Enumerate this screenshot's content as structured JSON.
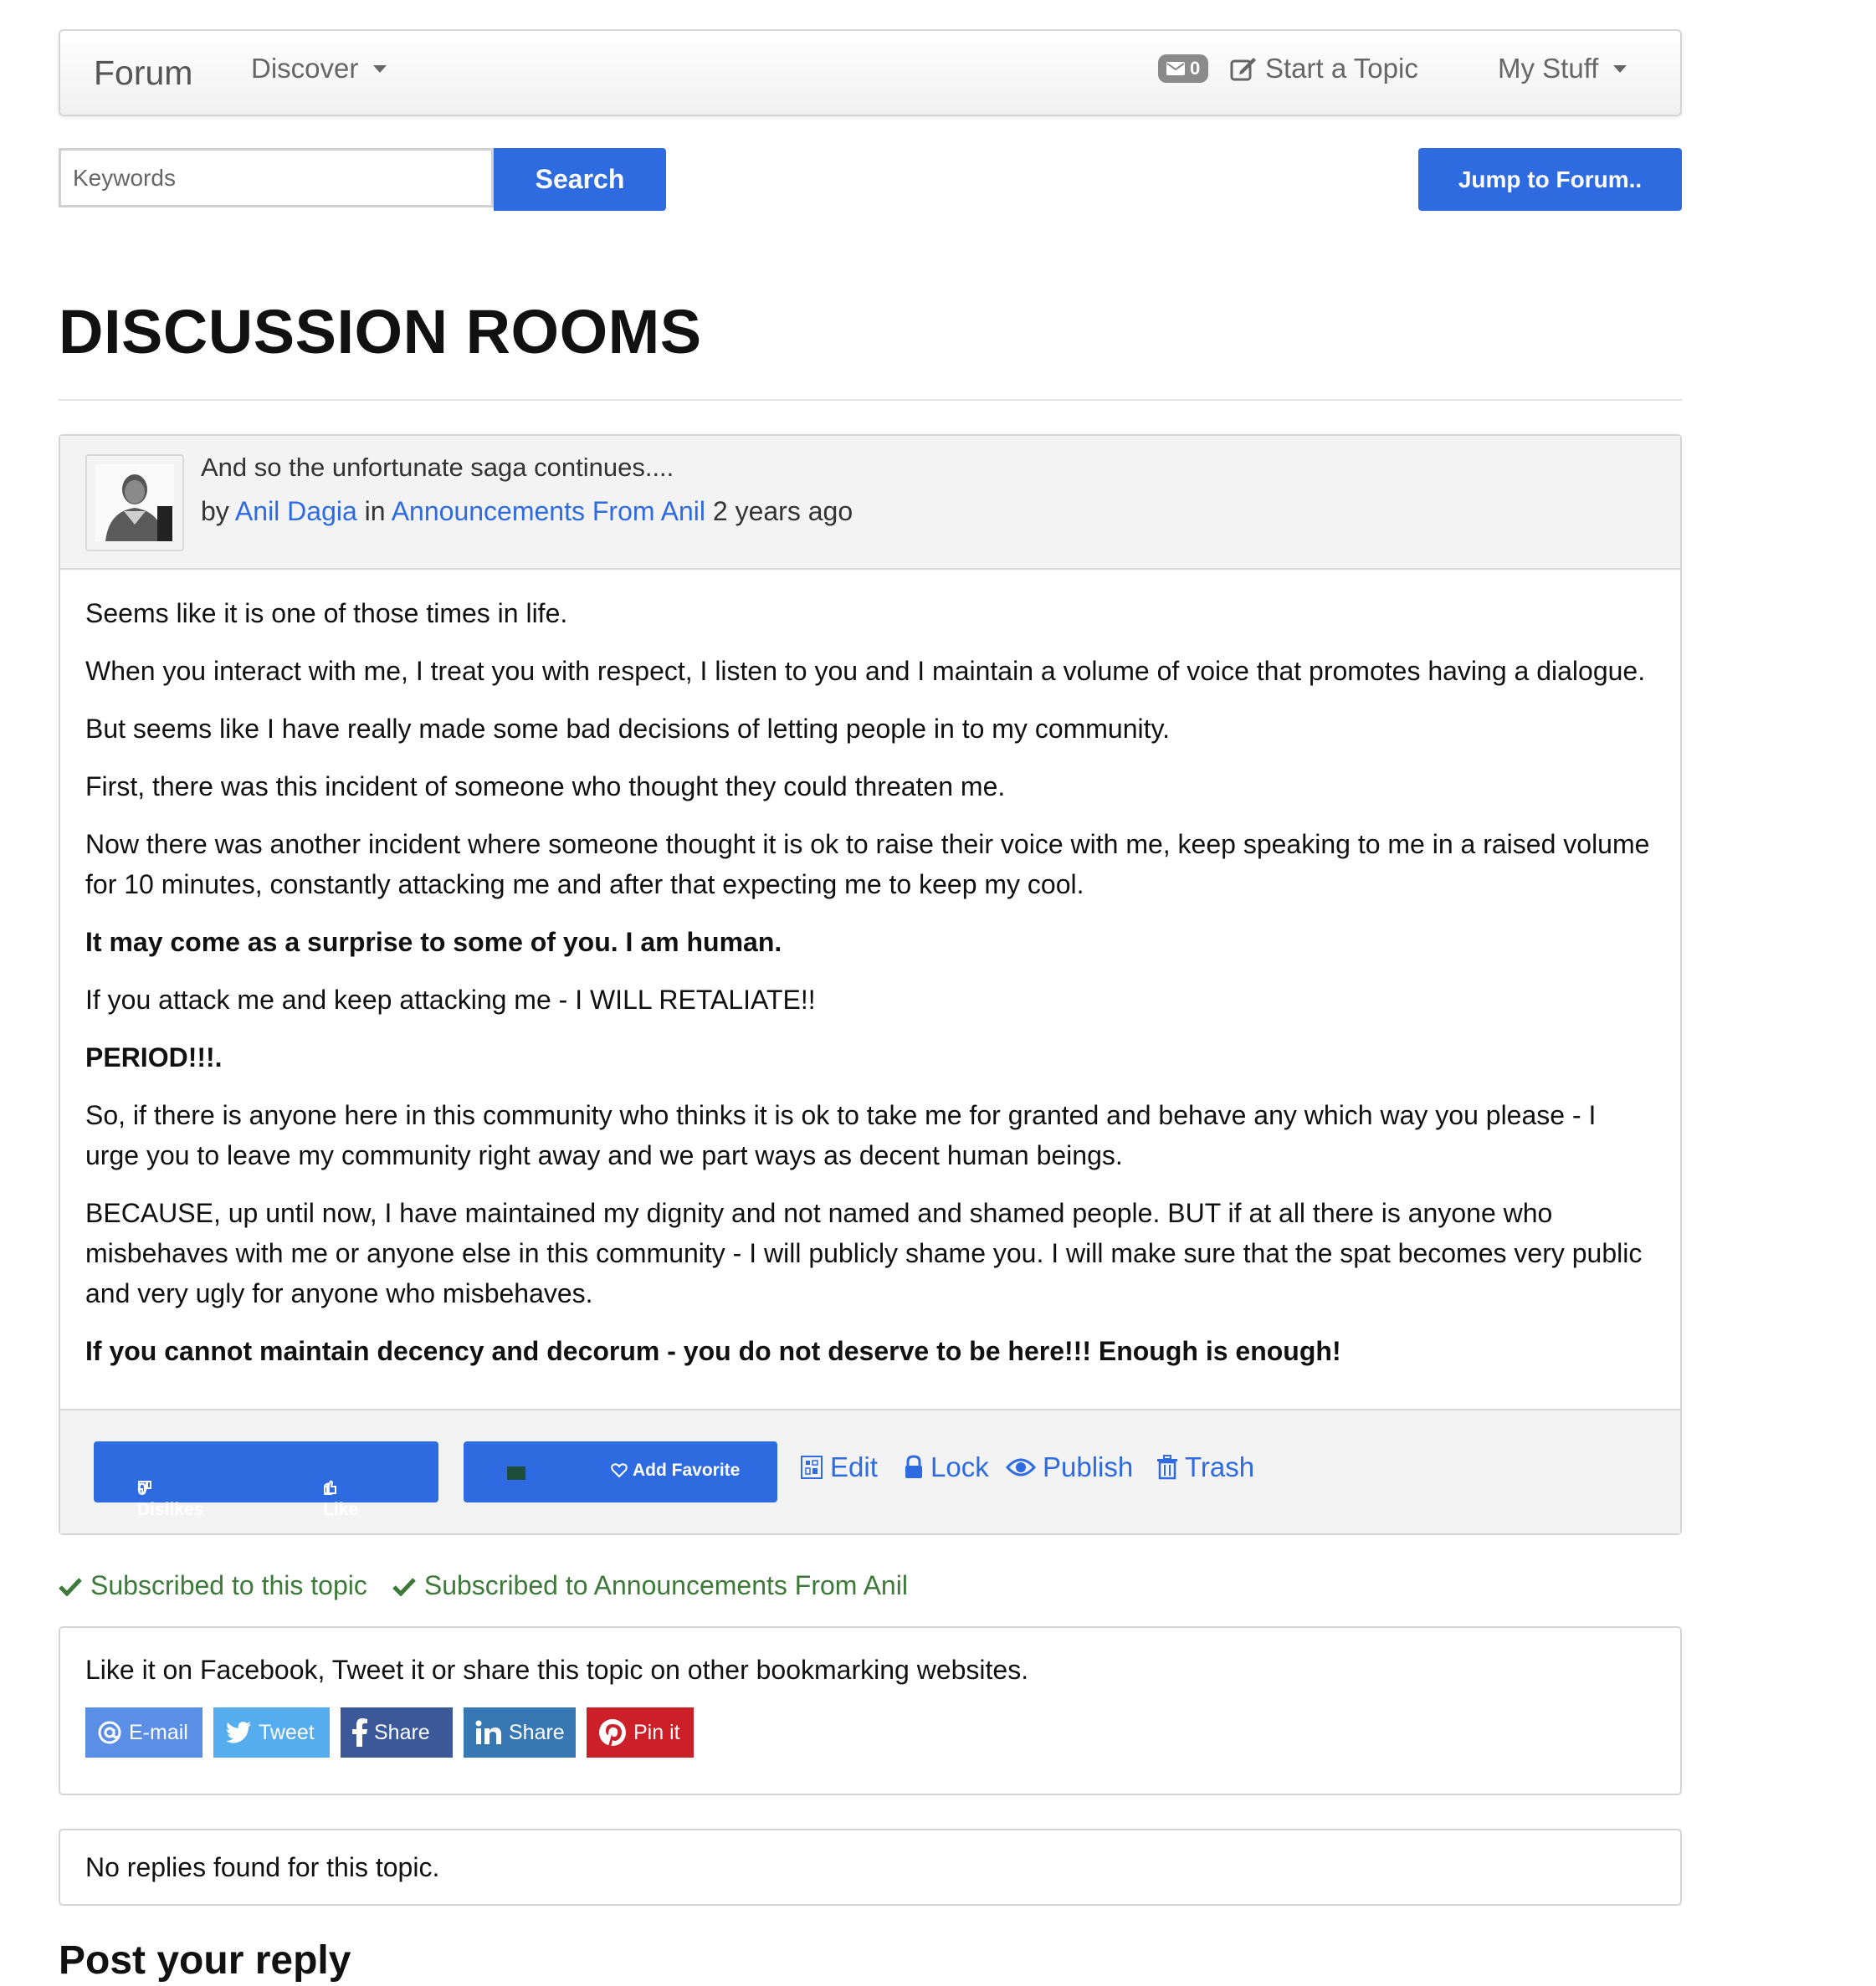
{
  "navbar": {
    "brand": "Forum",
    "discover": "Discover",
    "messages_count": "0",
    "start_topic": "Start a Topic",
    "my_stuff": "My Stuff"
  },
  "search": {
    "placeholder": "Keywords",
    "button": "Search",
    "jump": "Jump to Forum.."
  },
  "page_title": "DISCUSSION ROOMS",
  "topic": {
    "title": "And so the unfortunate saga continues....",
    "by": "by",
    "author": "Anil Dagia",
    "in": "in",
    "forum": "Announcements From Anil",
    "age": "2 years ago",
    "paragraphs": [
      {
        "text": "Seems like it is one of those times in life.",
        "bold": false
      },
      {
        "text": "When you interact with me, I treat you with respect, I listen to you and I maintain a volume of voice that promotes having a dialogue.",
        "bold": false
      },
      {
        "text": "But seems like I have really made some bad decisions of letting people in to my community.",
        "bold": false
      },
      {
        "text": "First, there was this incident of someone who thought they could threaten me.",
        "bold": false
      },
      {
        "text": "Now there was another incident where someone thought it is ok to raise their voice with me, keep speaking to me in a raised volume for 10 minutes, constantly attacking me and after that expecting me to keep my cool.",
        "bold": false
      },
      {
        "text": "It may come as a surprise to some of you. I am human.",
        "bold": true
      },
      {
        "text": "If you attack me and keep attacking me - I WILL RETALIATE!!",
        "bold": false
      },
      {
        "text": "PERIOD!!!.",
        "bold": true
      },
      {
        "text": "So, if there is anyone here in this community who thinks it is ok to take me for granted and behave any which way you please - I urge you to leave my community right away and we part ways as decent human beings.",
        "bold": false
      },
      {
        "text": "BECAUSE, up until now, I have maintained my dignity and not named and shamed people. BUT if at all there is anyone who misbehaves with me or anyone else in this community - I will publicly shame you. I will make sure that the spat becomes very public and very ugly for anyone who misbehaves.",
        "bold": false
      },
      {
        "text": "If you cannot maintain decency and decorum - you do not deserve to be here!!! Enough is enough!",
        "bold": true
      }
    ],
    "dislikes": "0 Dislikes",
    "likes": "1 Like",
    "add_favorite": "Add Favorite",
    "edit": "Edit",
    "lock": "Lock",
    "publish": "Publish",
    "trash": "Trash"
  },
  "subscriptions": {
    "topic": "Subscribed to this topic",
    "forum": "Subscribed to Announcements From Anil"
  },
  "share": {
    "text": "Like it on Facebook, Tweet it or share this topic on other bookmarking websites.",
    "email": "E-mail",
    "tweet": "Tweet",
    "facebook": "Share",
    "linkedin": "Share",
    "pinterest": "Pin it"
  },
  "replies": {
    "none": "No replies found for this topic."
  },
  "post_reply": "Post your reply",
  "colors": {
    "primary": "#2f6be0",
    "success": "#3d7a3a",
    "email": "#5b8fe6",
    "twitter": "#55acee",
    "facebook": "#3b5998",
    "linkedin": "#3677b4",
    "pinterest": "#cb2027"
  }
}
